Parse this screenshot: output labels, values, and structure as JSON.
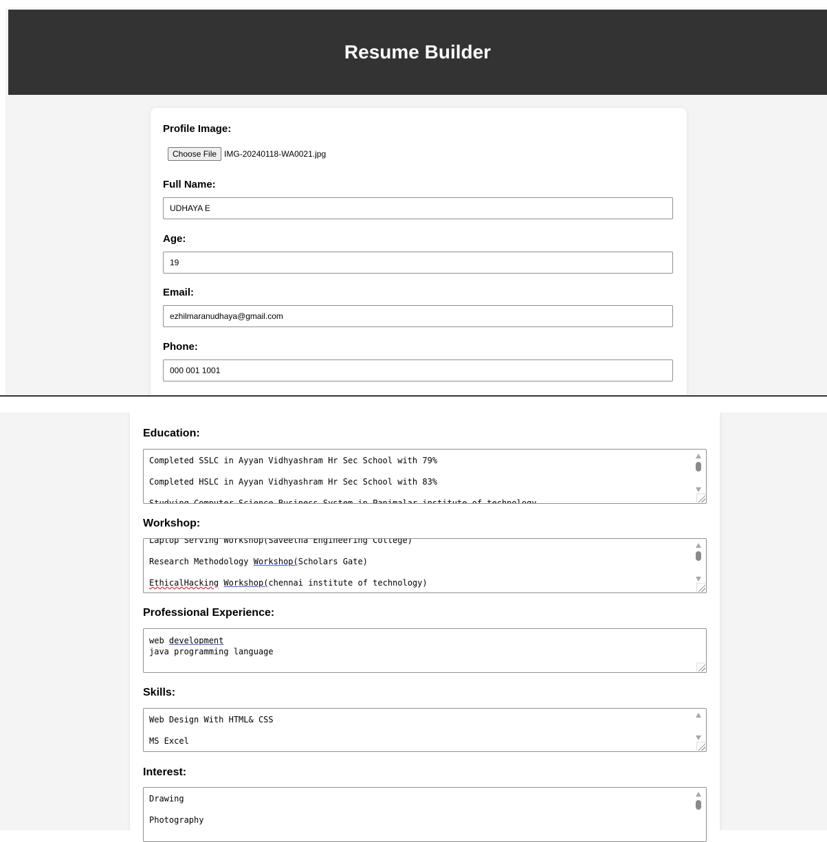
{
  "app": {
    "title": "Resume Builder"
  },
  "profile": {
    "label": "Profile Image:",
    "choose_file_label": "Choose File",
    "file_name": "IMG-20240118-WA0021.jpg"
  },
  "full_name": {
    "label": "Full Name:",
    "value": "UDHAYA E"
  },
  "age": {
    "label": "Age:",
    "value": "19"
  },
  "email": {
    "label": "Email:",
    "value": "ezhilmaranudhaya@gmail.com"
  },
  "phone": {
    "label": "Phone:",
    "value": "000 001 1001"
  },
  "education": {
    "label": "Education:",
    "lines": [
      "Completed SSLC in Ayyan Vidhyashram Hr Sec School with 79%",
      "Completed HSLC in Ayyan Vidhyashram Hr Sec School with 83%",
      "Studying Computer Science Business System in Panimalar institute of technology"
    ]
  },
  "workshop": {
    "label": "Workshop:",
    "line0": "Laptop Serving Workshop(Saveetha Engineering College)",
    "line1_a": "Research Methodology ",
    "line1_b": "Workshop(",
    "line1_c": "Scholars Gate)",
    "line2_a": "EthicalHacking",
    "line2_b": " ",
    "line2_c": "Workshop(",
    "line2_d": "chennai institute of technology)"
  },
  "experience": {
    "label": "Professional Experience:",
    "line0_a": "web ",
    "line0_b": "development",
    "line1": "java programming language"
  },
  "skills": {
    "label": "Skills:",
    "lines": [
      "Web Design With HTML& CSS",
      "MS Excel"
    ]
  },
  "interest": {
    "label": "Interest:",
    "lines": [
      "Drawing",
      "Photography"
    ]
  }
}
